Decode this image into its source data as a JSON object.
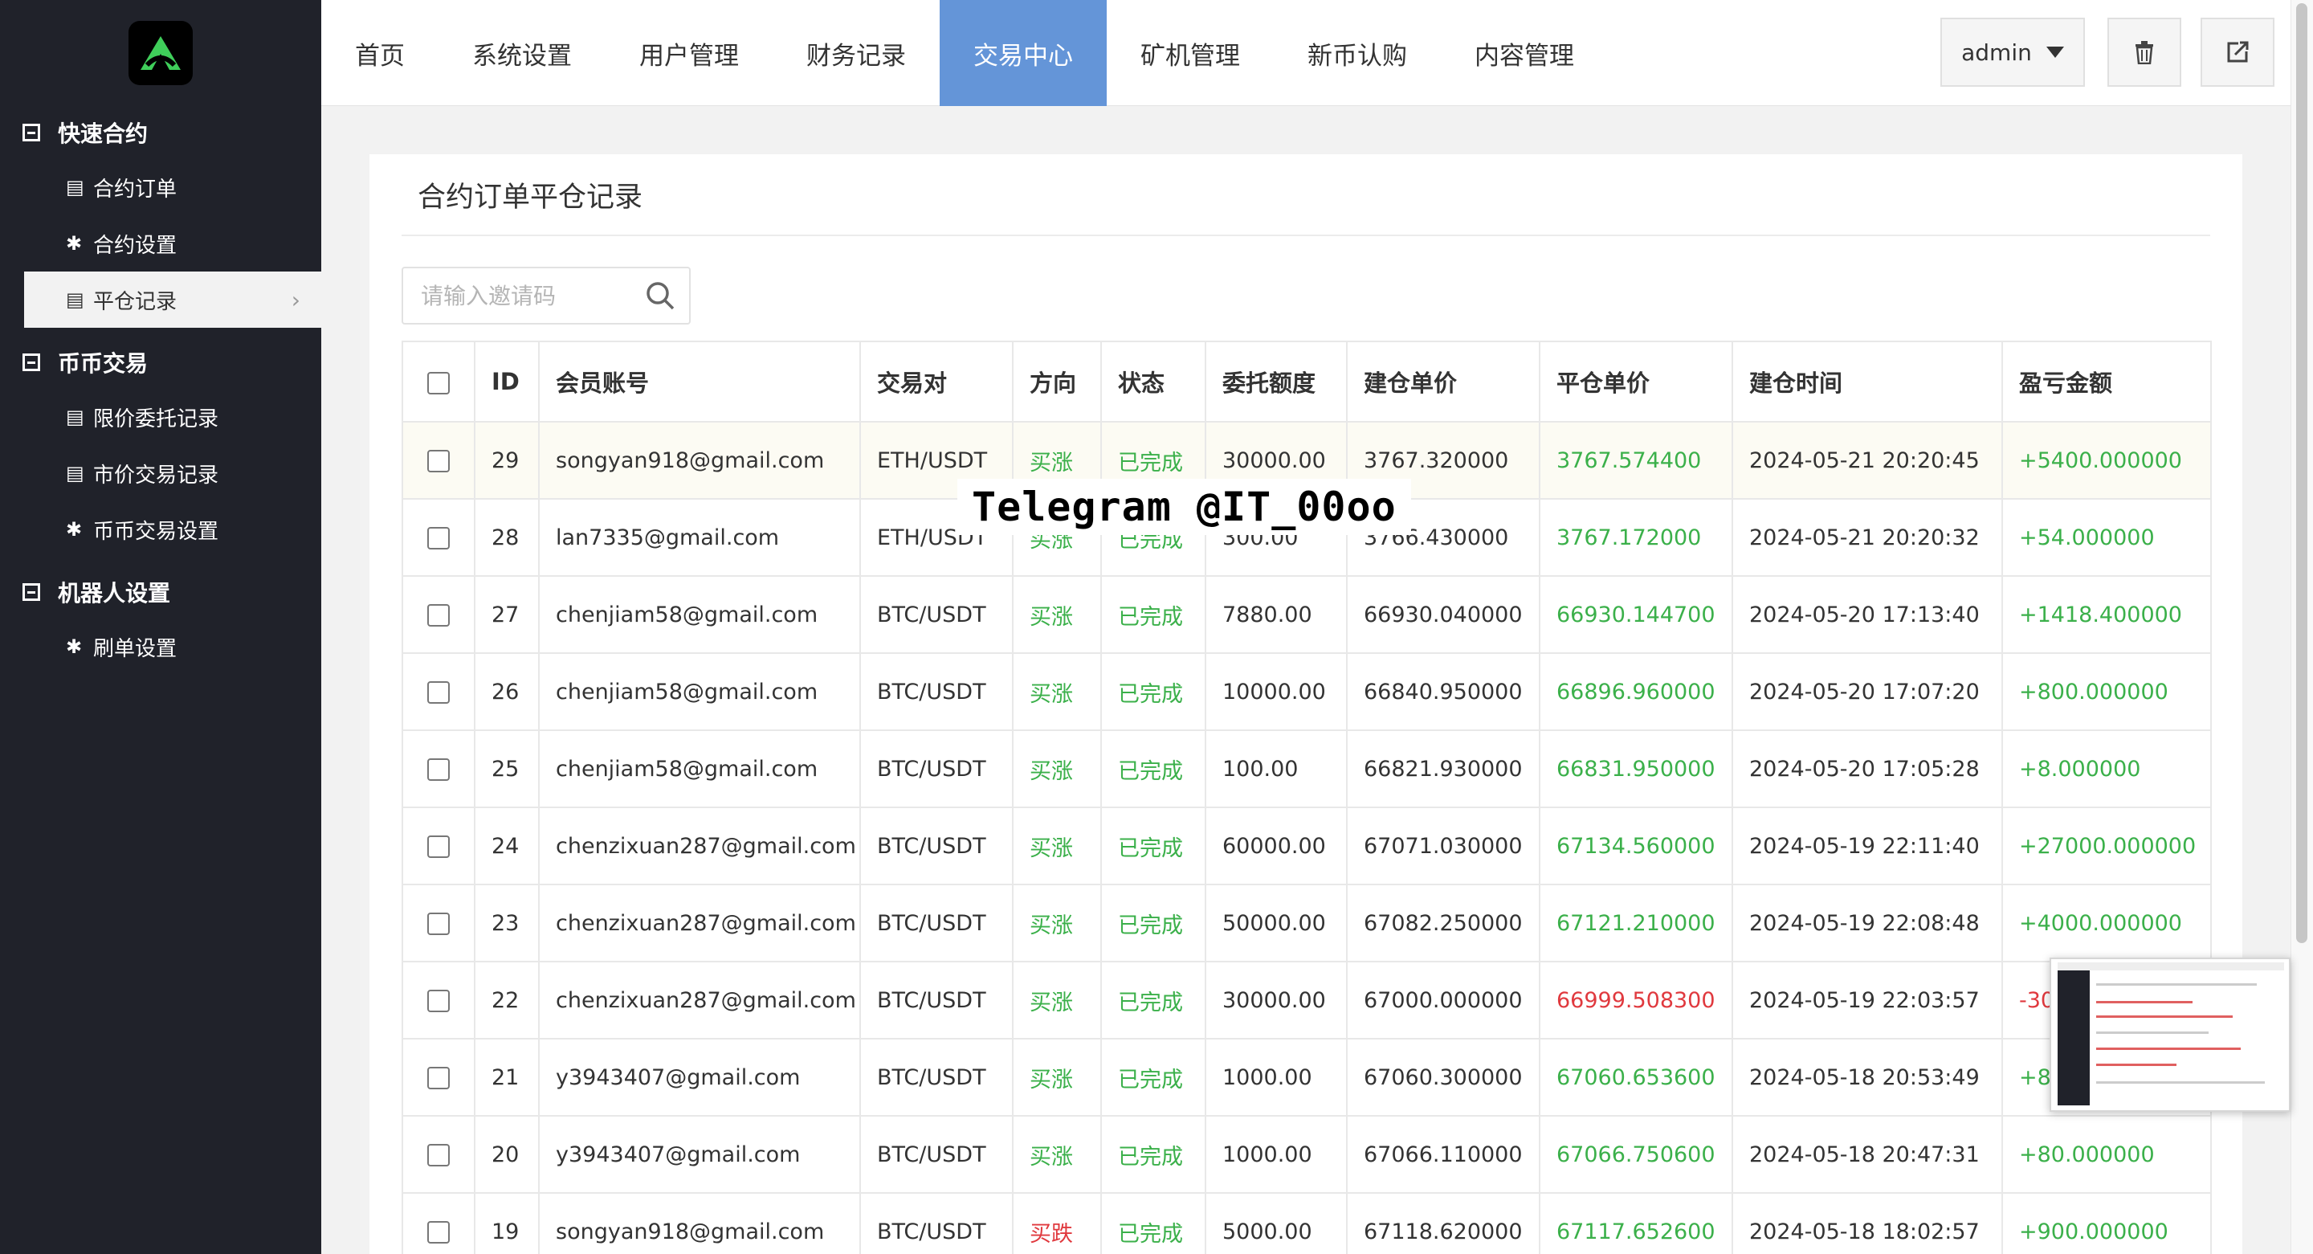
{
  "sidebar": {
    "groups": [
      {
        "title": "快速合约",
        "items": [
          {
            "icon": "list-icon",
            "glyph": "▤",
            "label": "合约订单"
          },
          {
            "icon": "gear-icon",
            "glyph": "✱",
            "label": "合约设置"
          },
          {
            "icon": "list-icon",
            "glyph": "▤",
            "label": "平仓记录",
            "active": true
          }
        ]
      },
      {
        "title": "币币交易",
        "items": [
          {
            "icon": "list-icon",
            "glyph": "▤",
            "label": "限价委托记录"
          },
          {
            "icon": "list-icon",
            "glyph": "▤",
            "label": "市价交易记录"
          },
          {
            "icon": "gear-icon",
            "glyph": "✱",
            "label": "币币交易设置"
          }
        ]
      },
      {
        "title": "机器人设置",
        "items": [
          {
            "icon": "gear-icon",
            "glyph": "✱",
            "label": "刷单设置"
          }
        ]
      }
    ]
  },
  "nav": {
    "items": [
      "首页",
      "系统设置",
      "用户管理",
      "财务记录",
      "交易中心",
      "矿机管理",
      "新币认购",
      "内容管理"
    ],
    "active_index": 4
  },
  "header": {
    "user": "admin"
  },
  "page": {
    "title": "合约订单平仓记录",
    "search_placeholder": "请输入邀请码"
  },
  "table": {
    "columns": [
      "ID",
      "会员账号",
      "交易对",
      "方向",
      "状态",
      "委托额度",
      "建仓单价",
      "平仓单价",
      "建仓时间",
      "盈亏金额"
    ],
    "rows": [
      {
        "id": "29",
        "account": "songyan918@gmail.com",
        "pair": "ETH/USDT",
        "direction": "买涨",
        "direction_color": "green",
        "status": "已完成",
        "amount": "30000.00",
        "open_price": "3767.320000",
        "close_price": "3767.574400",
        "close_color": "green",
        "open_time": "2024-05-21 20:20:45",
        "pnl": "+5400.000000",
        "pnl_color": "green"
      },
      {
        "id": "28",
        "account": "lan7335@gmail.com",
        "pair": "ETH/USDT",
        "direction": "买涨",
        "direction_color": "green",
        "status": "已完成",
        "amount": "300.00",
        "open_price": "3766.430000",
        "close_price": "3767.172000",
        "close_color": "green",
        "open_time": "2024-05-21 20:20:32",
        "pnl": "+54.000000",
        "pnl_color": "green"
      },
      {
        "id": "27",
        "account": "chenjiam58@gmail.com",
        "pair": "BTC/USDT",
        "direction": "买涨",
        "direction_color": "green",
        "status": "已完成",
        "amount": "7880.00",
        "open_price": "66930.040000",
        "close_price": "66930.144700",
        "close_color": "green",
        "open_time": "2024-05-20 17:13:40",
        "pnl": "+1418.400000",
        "pnl_color": "green"
      },
      {
        "id": "26",
        "account": "chenjiam58@gmail.com",
        "pair": "BTC/USDT",
        "direction": "买涨",
        "direction_color": "green",
        "status": "已完成",
        "amount": "10000.00",
        "open_price": "66840.950000",
        "close_price": "66896.960000",
        "close_color": "green",
        "open_time": "2024-05-20 17:07:20",
        "pnl": "+800.000000",
        "pnl_color": "green"
      },
      {
        "id": "25",
        "account": "chenjiam58@gmail.com",
        "pair": "BTC/USDT",
        "direction": "买涨",
        "direction_color": "green",
        "status": "已完成",
        "amount": "100.00",
        "open_price": "66821.930000",
        "close_price": "66831.950000",
        "close_color": "green",
        "open_time": "2024-05-20 17:05:28",
        "pnl": "+8.000000",
        "pnl_color": "green"
      },
      {
        "id": "24",
        "account": "chenzixuan287@gmail.com",
        "pair": "BTC/USDT",
        "direction": "买涨",
        "direction_color": "green",
        "status": "已完成",
        "amount": "60000.00",
        "open_price": "67071.030000",
        "close_price": "67134.560000",
        "close_color": "green",
        "open_time": "2024-05-19 22:11:40",
        "pnl": "+27000.000000",
        "pnl_color": "green"
      },
      {
        "id": "23",
        "account": "chenzixuan287@gmail.com",
        "pair": "BTC/USDT",
        "direction": "买涨",
        "direction_color": "green",
        "status": "已完成",
        "amount": "50000.00",
        "open_price": "67082.250000",
        "close_price": "67121.210000",
        "close_color": "green",
        "open_time": "2024-05-19 22:08:48",
        "pnl": "+4000.000000",
        "pnl_color": "green"
      },
      {
        "id": "22",
        "account": "chenzixuan287@gmail.com",
        "pair": "BTC/USDT",
        "direction": "买涨",
        "direction_color": "green",
        "status": "已完成",
        "amount": "30000.00",
        "open_price": "67000.000000",
        "close_price": "66999.508300",
        "close_color": "red",
        "open_time": "2024-05-19 22:03:57",
        "pnl": "-3000.000000",
        "pnl_color": "red"
      },
      {
        "id": "21",
        "account": "y3943407@gmail.com",
        "pair": "BTC/USDT",
        "direction": "买涨",
        "direction_color": "green",
        "status": "已完成",
        "amount": "1000.00",
        "open_price": "67060.300000",
        "close_price": "67060.653600",
        "close_color": "green",
        "open_time": "2024-05-18 20:53:49",
        "pnl": "+80.000000",
        "pnl_color": "green"
      },
      {
        "id": "20",
        "account": "y3943407@gmail.com",
        "pair": "BTC/USDT",
        "direction": "买涨",
        "direction_color": "green",
        "status": "已完成",
        "amount": "1000.00",
        "open_price": "67066.110000",
        "close_price": "67066.750600",
        "close_color": "green",
        "open_time": "2024-05-18 20:47:31",
        "pnl": "+80.000000",
        "pnl_color": "green"
      },
      {
        "id": "19",
        "account": "songyan918@gmail.com",
        "pair": "BTC/USDT",
        "direction": "买跌",
        "direction_color": "red",
        "status": "已完成",
        "amount": "5000.00",
        "open_price": "67118.620000",
        "close_price": "67117.652600",
        "close_color": "green",
        "open_time": "2024-05-18 18:02:57",
        "pnl": "+900.000000",
        "pnl_color": "green"
      }
    ]
  },
  "overlay": {
    "watermark": "Telegram @IT_00oo"
  },
  "colors": {
    "sidebar_bg": "#20222a",
    "nav_active": "#6495d8",
    "green": "#3bb04a",
    "red": "#e0393e"
  }
}
